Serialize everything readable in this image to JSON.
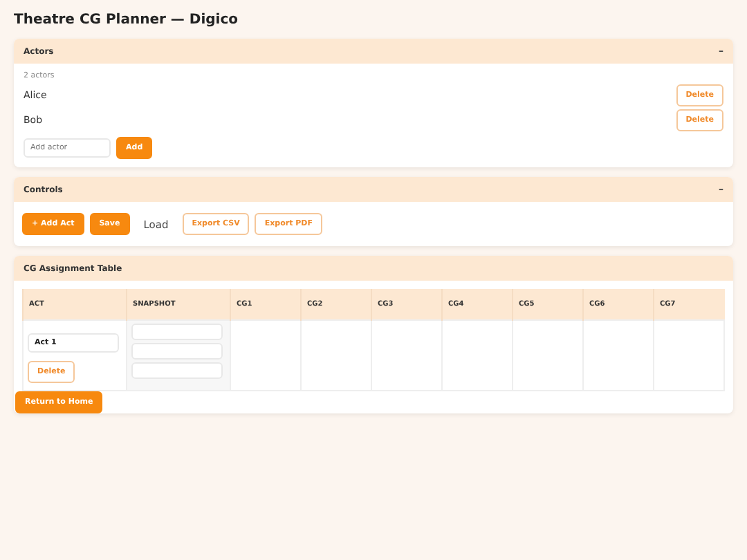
{
  "title": "Theatre CG Planner — Digico",
  "actors_panel": {
    "title": "Actors",
    "toggle": "–",
    "count": "2 actors",
    "actors": [
      {
        "name": "Alice",
        "action": "Delete"
      },
      {
        "name": "Bob",
        "action": "Delete"
      }
    ],
    "input": {
      "placeholder": "Add actor"
    },
    "add_button": "Add"
  },
  "controls_panel": {
    "title": "Controls",
    "toggle": "–",
    "buttons": [
      {
        "label": "+ Add Act",
        "kind": "primary"
      },
      {
        "label": "Save",
        "kind": "primary"
      },
      {
        "label": "Load",
        "kind": "plain"
      },
      {
        "label": "Export CSV",
        "kind": "outline"
      },
      {
        "label": "Export PDF",
        "kind": "outline"
      }
    ]
  },
  "table_panel": {
    "title": "CG Assignment Table",
    "columns": [
      "ACT",
      "SNAPSHOT",
      "CG1",
      "CG2",
      "CG3",
      "CG4",
      "CG5",
      "CG6",
      "CG7"
    ],
    "rows": [
      {
        "act": "Act 1",
        "action": "Delete"
      }
    ]
  },
  "return_button": "Return to Home"
}
